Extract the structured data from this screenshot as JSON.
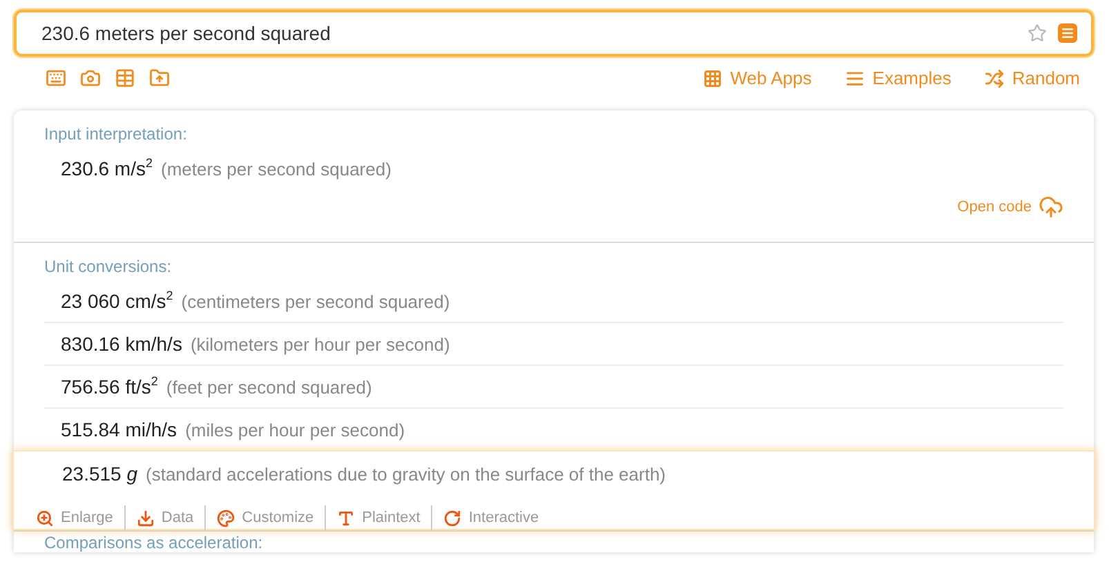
{
  "search": {
    "value": "230.6 meters per second squared"
  },
  "tools": [
    {
      "kind": "keyboard"
    },
    {
      "kind": "camera"
    },
    {
      "kind": "table"
    },
    {
      "kind": "upload"
    }
  ],
  "nav": [
    {
      "kind": "grid",
      "label": "Web Apps"
    },
    {
      "kind": "menu",
      "label": "Examples"
    },
    {
      "kind": "shuffle",
      "label": "Random"
    }
  ],
  "pods": [
    {
      "title": "Input interpretation:",
      "rows": [
        {
          "value": "230.6 m/s$^{2}$",
          "note": "(meters per second squared)",
          "selected": false
        }
      ],
      "link": "Open code"
    },
    {
      "title": "Unit conversions:",
      "rows": [
        {
          "value": "23 060 cm/s$^{2}$",
          "note": "(centimeters per second squared)",
          "selected": false
        },
        {
          "value": "830.16 km/h/s",
          "note": "(kilometers per hour per second)",
          "selected": false
        },
        {
          "value": "756.56 ft/s$^{2}$",
          "note": "(feet per second squared)",
          "selected": false
        },
        {
          "value": "515.84 mi/h/s",
          "note": "(miles per hour per second)",
          "selected": false
        },
        {
          "value": "23.515 *g*",
          "note": "(standard accelerations due to gravity on the surface of the earth)",
          "selected": true
        }
      ]
    },
    {
      "title": "Comparisons as acceleration:"
    }
  ],
  "row_actions": [
    {
      "kind": "enlarge",
      "label": "Enlarge"
    },
    {
      "kind": "data",
      "label": "Data"
    },
    {
      "kind": "customize",
      "label": "Customize"
    },
    {
      "kind": "plaintext",
      "label": "Plaintext"
    },
    {
      "kind": "interactive",
      "label": "Interactive"
    }
  ]
}
